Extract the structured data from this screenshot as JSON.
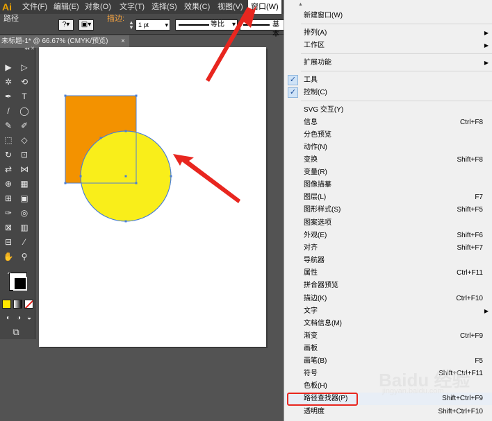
{
  "app": {
    "logo": "Ai"
  },
  "menubar": {
    "items": [
      "文件(F)",
      "编辑(E)",
      "对象(O)",
      "文字(T)",
      "选择(S)",
      "效果(C)",
      "视图(V)",
      "窗口(W)"
    ],
    "active": "窗口(W)"
  },
  "controlbar": {
    "selection_label": "路径",
    "stroke_label": "描边:",
    "stroke_value": "1 pt",
    "line_style_1": "等比",
    "line_style_2": "基本",
    "question_mark": "?"
  },
  "document": {
    "tab_title": "未标题-1* @ 66.67% (CMYK/预览)",
    "tab_close": "×"
  },
  "toolbar": {
    "panel_controls": "◂◂ ✕",
    "tools": [
      "▶",
      "▷",
      "✲",
      "⟲",
      "✒",
      "T",
      "/",
      "◯",
      "✎",
      "✐",
      "⬚",
      "◇",
      "↻",
      "⊡",
      "⇄",
      "⋈",
      "⊕",
      "▦",
      "⊞",
      "▣",
      "✑",
      "◎",
      "⊠",
      "▥",
      "⊟",
      "⁄",
      "✋",
      "⚲"
    ],
    "help": "?"
  },
  "colors": {
    "rect_fill": "#f39200",
    "circle_fill": "#f9ee1a",
    "selection": "#4a7fd6",
    "arrow": "#e8261f",
    "menu_check_bg": "#cfe3f7"
  },
  "window_menu": {
    "scroll_up": "▲",
    "groups": [
      [
        {
          "label": "新建窗口(W)",
          "shortcut": ""
        }
      ],
      [
        {
          "label": "排列(A)",
          "submenu": true
        },
        {
          "label": "工作区",
          "submenu": true
        }
      ],
      [
        {
          "label": "扩展功能",
          "submenu": true
        }
      ],
      [
        {
          "label": "工具",
          "checked": true
        },
        {
          "label": "控制(C)",
          "checked": true
        }
      ],
      [
        {
          "label": "SVG 交互(Y)",
          "shortcut": ""
        },
        {
          "label": "信息",
          "shortcut": "Ctrl+F8"
        },
        {
          "label": "分色预览",
          "shortcut": ""
        },
        {
          "label": "动作(N)",
          "shortcut": ""
        },
        {
          "label": "变换",
          "shortcut": "Shift+F8"
        },
        {
          "label": "变量(R)",
          "shortcut": ""
        },
        {
          "label": "图像描摹",
          "shortcut": ""
        },
        {
          "label": "图层(L)",
          "shortcut": "F7"
        },
        {
          "label": "图形样式(S)",
          "shortcut": "Shift+F5"
        },
        {
          "label": "图案选项",
          "shortcut": ""
        },
        {
          "label": "外观(E)",
          "shortcut": "Shift+F6"
        },
        {
          "label": "对齐",
          "shortcut": "Shift+F7"
        },
        {
          "label": "导航器",
          "shortcut": ""
        },
        {
          "label": "属性",
          "shortcut": "Ctrl+F11"
        },
        {
          "label": "拼合器预览",
          "shortcut": ""
        },
        {
          "label": "描边(K)",
          "shortcut": "Ctrl+F10"
        },
        {
          "label": "文字",
          "submenu": true
        },
        {
          "label": "文档信息(M)",
          "shortcut": ""
        },
        {
          "label": "渐变",
          "shortcut": "Ctrl+F9"
        },
        {
          "label": "画板",
          "shortcut": ""
        },
        {
          "label": "画笔(B)",
          "shortcut": "F5"
        },
        {
          "label": "符号",
          "shortcut": "Shift+Ctrl+F11"
        },
        {
          "label": "色板(H)",
          "shortcut": ""
        },
        {
          "label": "路径查找器(P)",
          "shortcut": "Shift+Ctrl+F9",
          "highlighted": true
        },
        {
          "label": "透明度",
          "shortcut": "Shift+Ctrl+F10"
        }
      ]
    ]
  },
  "watermark": {
    "text": "Baidu 经验",
    "sub": "jingyan.baidu.com"
  }
}
